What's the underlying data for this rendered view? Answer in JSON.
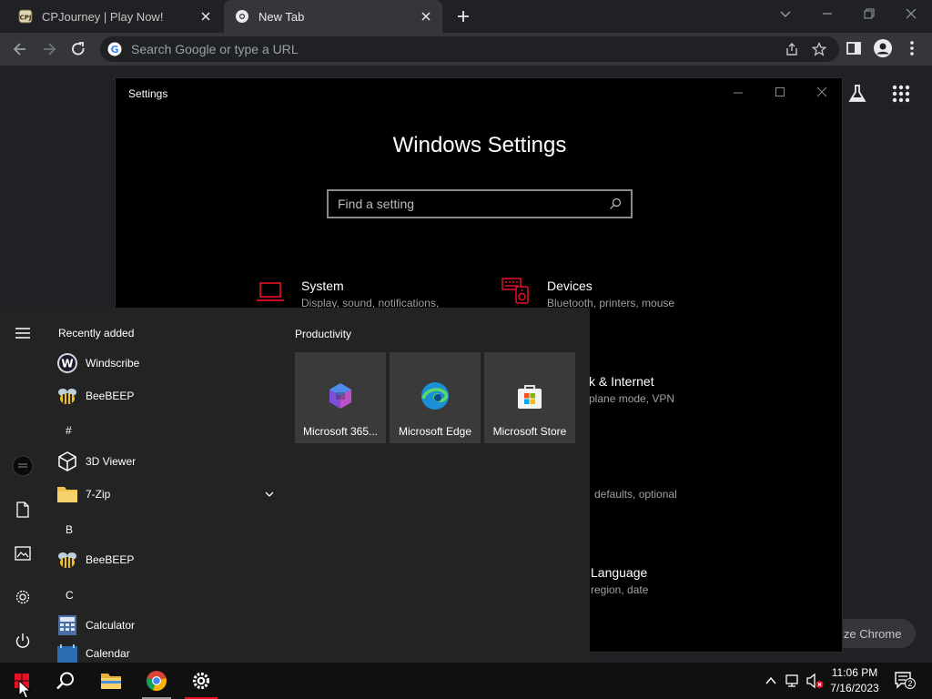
{
  "browser": {
    "tabs": [
      {
        "title": "CPJourney | Play Now!",
        "active": false
      },
      {
        "title": "New Tab",
        "active": true
      }
    ],
    "omnibox_placeholder": "Search Google or type a URL",
    "customize_label": "ize Chrome"
  },
  "settings": {
    "window_title": "Settings",
    "heading": "Windows Settings",
    "search_placeholder": "Find a setting",
    "categories": [
      {
        "title": "System",
        "desc": "Display, sound, notifications,"
      },
      {
        "title": "Devices",
        "desc": "Bluetooth, printers, mouse"
      },
      {
        "title": "k & Internet",
        "desc": "plane mode, VPN"
      },
      {
        "title": "",
        "desc": "defaults, optional"
      },
      {
        "title": "Language",
        "desc": "region, date"
      }
    ]
  },
  "start_menu": {
    "recent_heading": "Recently added",
    "productivity_heading": "Productivity",
    "apps": [
      {
        "label": "Windscribe"
      },
      {
        "label": "BeeBEEP"
      },
      {
        "letter": "#"
      },
      {
        "label": "3D Viewer"
      },
      {
        "label": "7-Zip"
      },
      {
        "letter": "B"
      },
      {
        "label": "BeeBEEP"
      },
      {
        "letter": "C"
      },
      {
        "label": "Calculator"
      },
      {
        "label": "Calendar"
      }
    ],
    "tiles": [
      {
        "label": "Microsoft 365..."
      },
      {
        "label": "Microsoft Edge"
      },
      {
        "label": "Microsoft Store"
      }
    ]
  },
  "taskbar": {
    "time": "11:06 PM",
    "date": "7/16/2023",
    "notification_count": "2"
  },
  "colors": {
    "accent_red": "#e81123",
    "settings_icon_red": "#e81123"
  }
}
